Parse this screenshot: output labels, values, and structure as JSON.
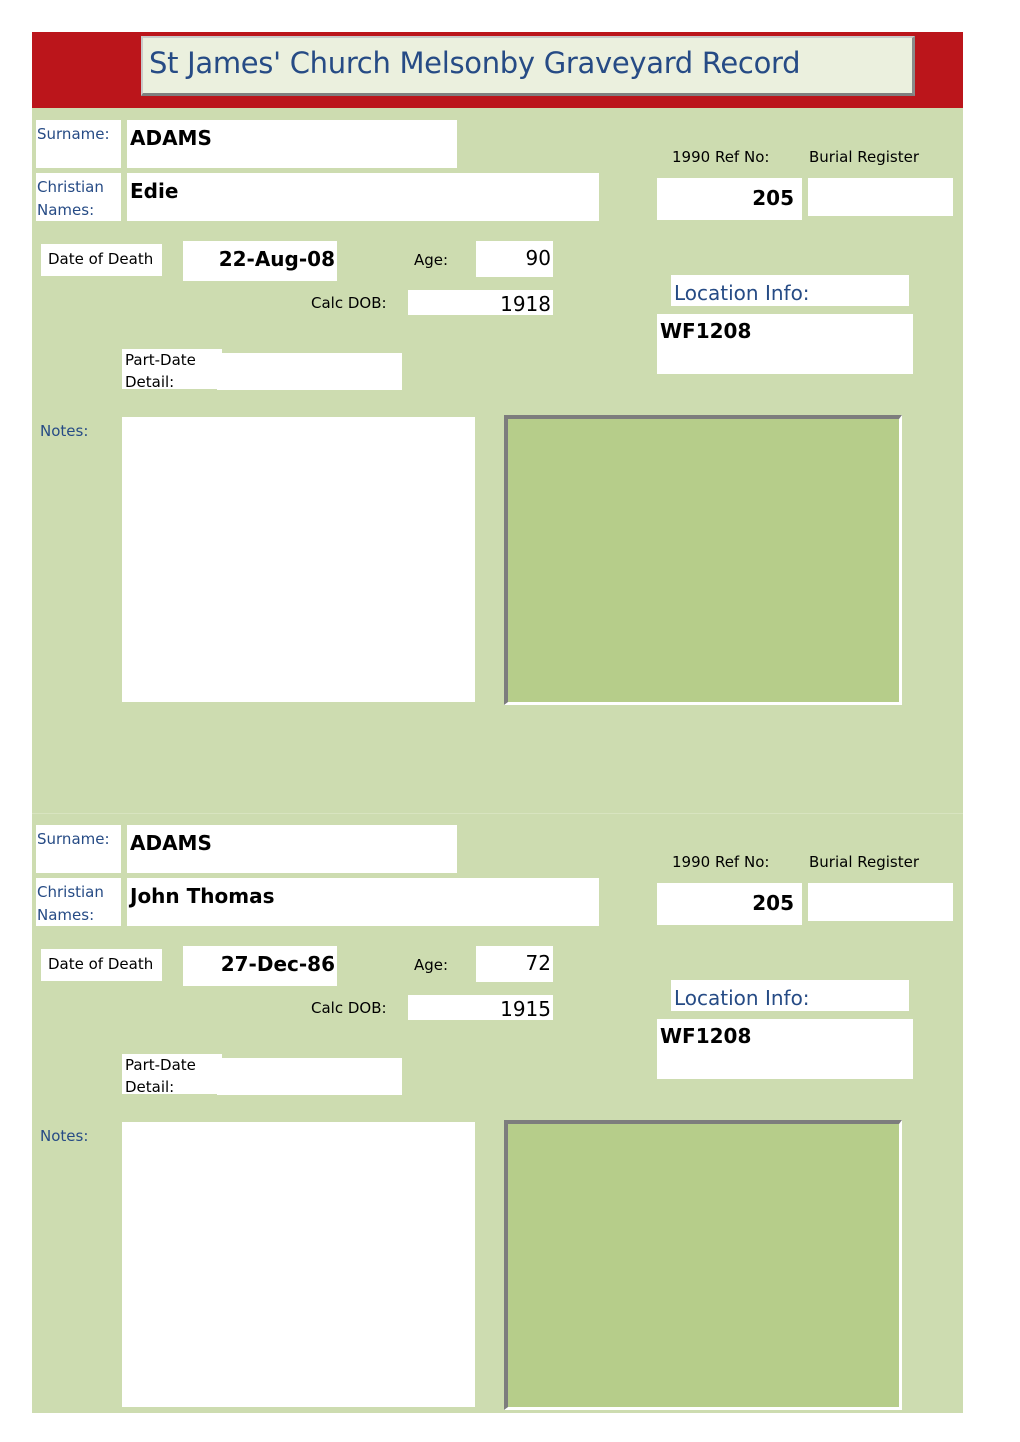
{
  "title": "St James' Church Melsonby Graveyard Record",
  "labels": {
    "surname": "Surname:",
    "christian_1": "Christian",
    "christian_2": "Names:",
    "ref_no": "1990 Ref No:",
    "burial_register": "Burial Register",
    "date_of_death": "Date of Death",
    "age": "Age:",
    "calc_dob": "Calc DOB:",
    "location_info": "Location Info:",
    "part_date_1": "Part-Date",
    "part_date_2": "Detail:",
    "notes": "Notes:"
  },
  "records": [
    {
      "surname": "ADAMS",
      "christian_names": "Edie",
      "ref_no": "205",
      "burial_register": "",
      "date_of_death": "22-Aug-08",
      "age": "90",
      "calc_dob": "1918",
      "location": "WF1208",
      "part_date_detail": "",
      "notes": ""
    },
    {
      "surname": "ADAMS",
      "christian_names": "John Thomas",
      "ref_no": "205",
      "burial_register": "",
      "date_of_death": "27-Dec-86",
      "age": "72",
      "calc_dob": "1915",
      "location": "WF1208",
      "part_date_detail": "",
      "notes": ""
    }
  ]
}
